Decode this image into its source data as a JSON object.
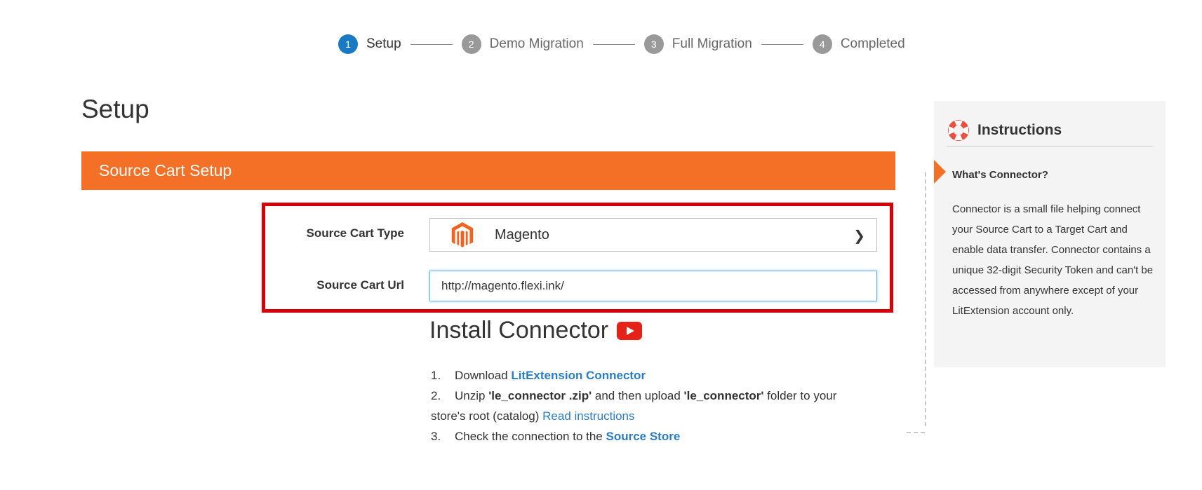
{
  "stepper": {
    "steps": [
      {
        "num": "1",
        "label": "Setup"
      },
      {
        "num": "2",
        "label": "Demo Migration"
      },
      {
        "num": "3",
        "label": "Full Migration"
      },
      {
        "num": "4",
        "label": "Completed"
      }
    ],
    "active_step": 1
  },
  "page_title": "Setup",
  "section": {
    "title": "Source Cart Setup"
  },
  "form": {
    "cart_type_label": "Source Cart Type",
    "cart_type_value": "Magento",
    "cart_url_label": "Source Cart Url",
    "cart_url_value": "http://magento.flexi.ink/"
  },
  "install": {
    "title": "Install Connector",
    "steps": [
      {
        "num": "1.",
        "text_before": "Download ",
        "link": "LitExtension Connector"
      },
      {
        "num": "2.",
        "text_before": "Unzip ",
        "bold1": "'le_connector .zip'",
        "text_mid": " and then upload ",
        "bold2": "'le_connector'",
        "text_after": " folder to your store's root (catalog) ",
        "link": "Read instructions"
      },
      {
        "num": "3.",
        "text_before": "Check the connection to the ",
        "link": "Source Store"
      }
    ]
  },
  "instructions": {
    "title": "Instructions",
    "subtitle": "What's Connector?",
    "body": "Connector is a small file helping connect your Source Cart to a Target Cart and enable data transfer. Connector contains a unique 32-digit Security Token and can't be accessed from anywhere except of your LitExtension account only."
  },
  "colors": {
    "accent_orange": "#f37026",
    "active_step_blue": "#1979c3",
    "highlight_red": "#d6000b",
    "link_blue": "#2c7cc1"
  },
  "icons": {
    "cart_logo": "magento-logo-icon",
    "video": "youtube-icon",
    "instructions": "lifebuoy-icon",
    "select_arrow": "chevron-right-icon"
  }
}
